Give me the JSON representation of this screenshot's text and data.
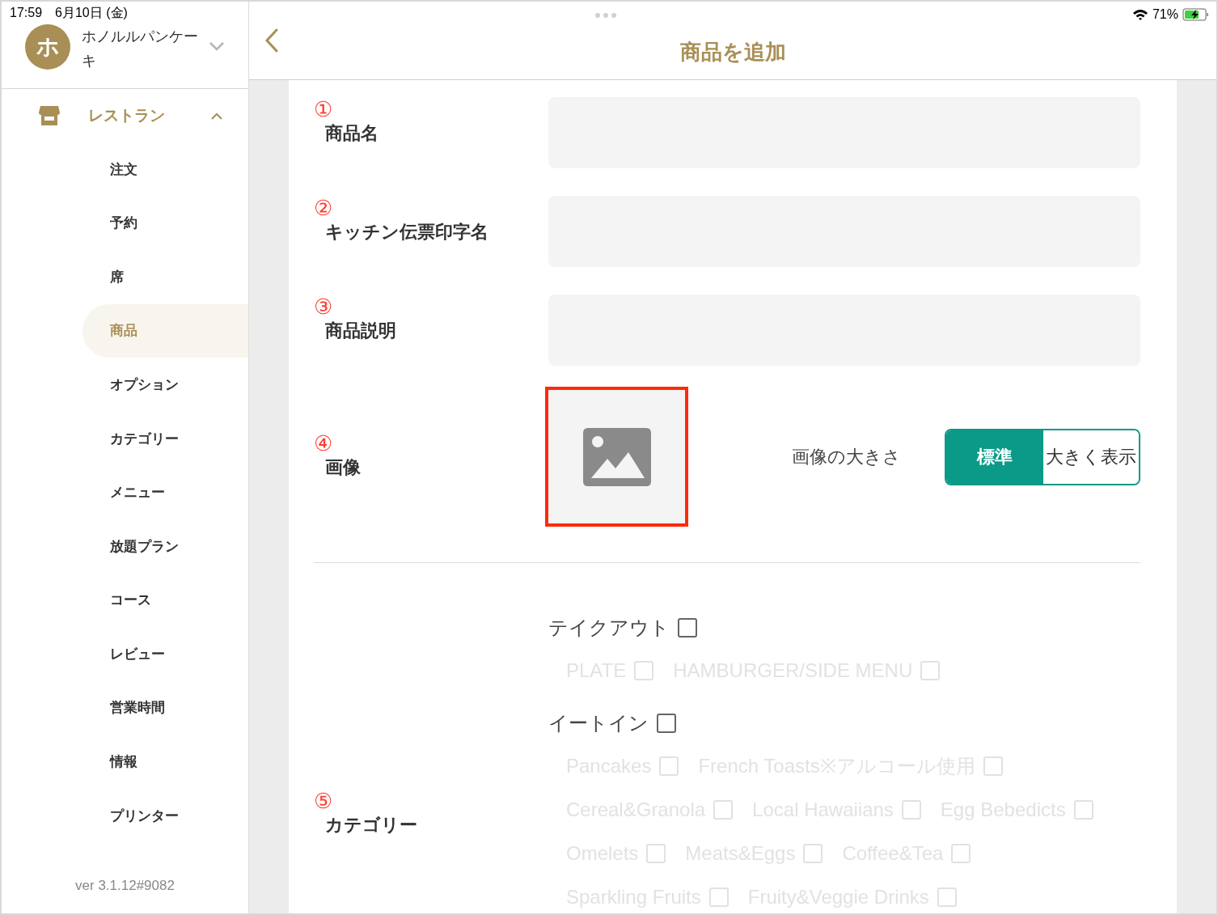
{
  "status_bar": {
    "time": "17:59",
    "date": "6月10日 (金)",
    "battery": "71%"
  },
  "sidebar": {
    "account": {
      "initial": "ホ",
      "name": "ホノルルパンケーキ"
    },
    "section": {
      "label": "レストラン",
      "expanded": true
    },
    "items": [
      {
        "label": "注文",
        "selected": false
      },
      {
        "label": "予約",
        "selected": false
      },
      {
        "label": "席",
        "selected": false
      },
      {
        "label": "商品",
        "selected": true
      },
      {
        "label": "オプション",
        "selected": false
      },
      {
        "label": "カテゴリー",
        "selected": false
      },
      {
        "label": "メニュー",
        "selected": false
      },
      {
        "label": "放題プラン",
        "selected": false
      },
      {
        "label": "コース",
        "selected": false
      },
      {
        "label": "レビュー",
        "selected": false
      },
      {
        "label": "営業時間",
        "selected": false
      },
      {
        "label": "情報",
        "selected": false
      },
      {
        "label": "プリンター",
        "selected": false
      }
    ],
    "version": "ver 3.1.12#9082"
  },
  "header": {
    "title": "商品を追加"
  },
  "fields": [
    {
      "marker": "①",
      "label": "商品名"
    },
    {
      "marker": "②",
      "label": "キッチン伝票印字名"
    },
    {
      "marker": "③",
      "label": "商品説明"
    }
  ],
  "image": {
    "marker": "④",
    "label": "画像",
    "size_label": "画像の大きさ",
    "size_options": [
      {
        "label": "標準",
        "selected": true
      },
      {
        "label": "大きく表示",
        "selected": false
      }
    ]
  },
  "category": {
    "marker": "⑤",
    "label": "カテゴリー",
    "groups": [
      {
        "label": "テイクアウト",
        "checked": false,
        "items": [
          {
            "label": "PLATE",
            "checked": false,
            "disabled": true
          },
          {
            "label": "HAMBURGER/SIDE MENU",
            "checked": false,
            "disabled": true
          }
        ]
      },
      {
        "label": "イートイン",
        "checked": false,
        "items": [
          {
            "label": "Pancakes",
            "checked": false,
            "disabled": true
          },
          {
            "label": "French Toasts※アルコール使用",
            "checked": false,
            "disabled": true
          },
          {
            "label": "Cereal&Granola",
            "checked": false,
            "disabled": true
          },
          {
            "label": "Local Hawaiians",
            "checked": false,
            "disabled": true
          },
          {
            "label": "Egg Bebedicts",
            "checked": false,
            "disabled": true
          },
          {
            "label": "Omelets",
            "checked": false,
            "disabled": true
          },
          {
            "label": "Meats&Eggs",
            "checked": false,
            "disabled": true
          },
          {
            "label": "Coffee&Tea",
            "checked": false,
            "disabled": true
          },
          {
            "label": "Sparkling Fruits",
            "checked": false,
            "disabled": true
          },
          {
            "label": "Fruity&Veggie Drinks",
            "checked": false,
            "disabled": true
          }
        ]
      }
    ]
  }
}
